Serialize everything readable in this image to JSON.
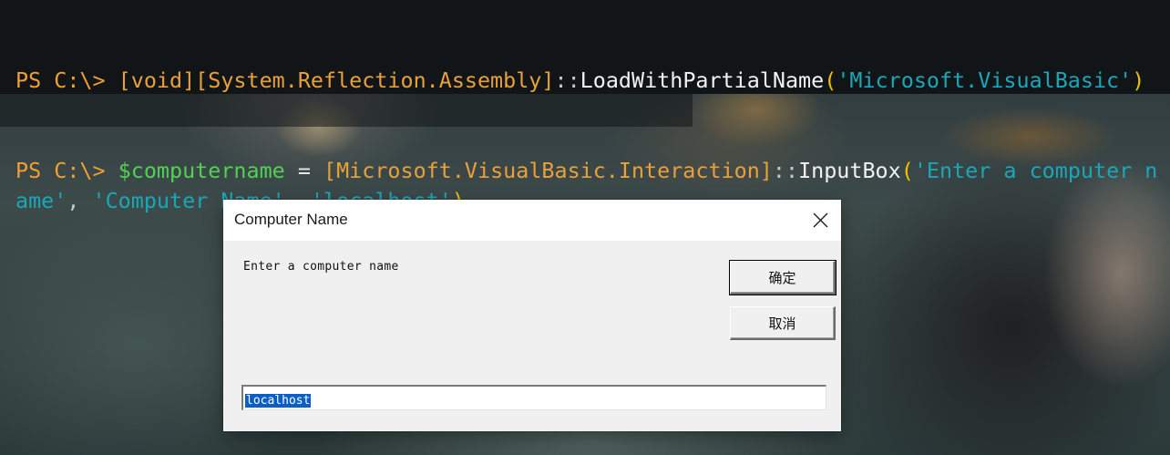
{
  "console": {
    "line1": {
      "prompt": "PS C:\\> ",
      "type_expr": "[void][System.Reflection.Assembly]",
      "op": "::",
      "method": "LoadWithPartialName",
      "paren_open": "(",
      "arg": "'Microsoft.VisualBasic'",
      "paren_close": ")"
    },
    "line2": {
      "prompt": "PS C:\\> ",
      "variable": "$computername",
      "assign": " = ",
      "type_expr": "[Microsoft.VisualBasic.Interaction]",
      "op": "::",
      "method": "InputBox",
      "paren_open": "(",
      "arg1": "'Enter a computer name'",
      "sep1": ", ",
      "arg2": "'Computer Name'",
      "sep2": ", ",
      "arg3": "'localhost'",
      "paren_close": ")"
    }
  },
  "dialog": {
    "title": "Computer Name",
    "prompt": "Enter a computer name",
    "ok_label": "确定",
    "cancel_label": "取消",
    "input_value": "localhost",
    "close_icon": "close-icon"
  },
  "colors": {
    "console_prompt": "#f0a030",
    "console_string": "#1aa7b8",
    "console_variable": "#52d152",
    "selection": "#0a5fc6"
  }
}
